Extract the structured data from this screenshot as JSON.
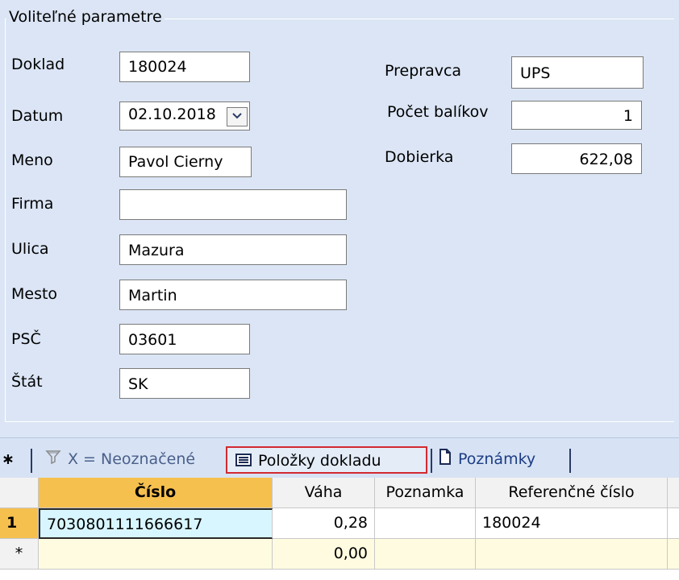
{
  "group": {
    "title": "Voliteľné parametre"
  },
  "form_left": [
    {
      "label": "Doklad",
      "value": "180024"
    },
    {
      "label": "Datum",
      "value": "02.10.2018"
    },
    {
      "label": "Meno",
      "value": "Pavol Cierny"
    },
    {
      "label": "Firma",
      "value": ""
    },
    {
      "label": "Ulica",
      "value": "Mazura"
    },
    {
      "label": "Mesto",
      "value": "Martin"
    },
    {
      "label": "PSČ",
      "value": "03601"
    },
    {
      "label": "Štát",
      "value": "SK"
    }
  ],
  "form_right": [
    {
      "label": "Prepravca",
      "value": "UPS"
    },
    {
      "label": "Počet balíkov",
      "value": "1"
    },
    {
      "label": "Dobierka",
      "value": "622,08"
    }
  ],
  "tabs": {
    "new_marker": "∗",
    "filter": "X = Neoznačené",
    "items": "Položky dokladu",
    "notes": "Poznámky"
  },
  "grid": {
    "columns": [
      "Číslo",
      "Váha",
      "Poznamka",
      "Referenčné číslo"
    ],
    "rows": [
      {
        "row_header": "1",
        "cislo": "7030801111666617",
        "vaha": "0,28",
        "poznamka": "",
        "referencne": "180024"
      },
      {
        "row_header": "*",
        "cislo": "",
        "vaha": "0,00",
        "poznamka": "",
        "referencne": ""
      }
    ]
  },
  "colors": {
    "background": "#dbe5f5",
    "active_header": "#f6c04f",
    "selected_tab_border": "#d22a30",
    "new_row": "#fffbe0"
  },
  "icons": [
    "calendar-dropdown-icon",
    "filter-icon",
    "list-icon",
    "page-icon"
  ]
}
